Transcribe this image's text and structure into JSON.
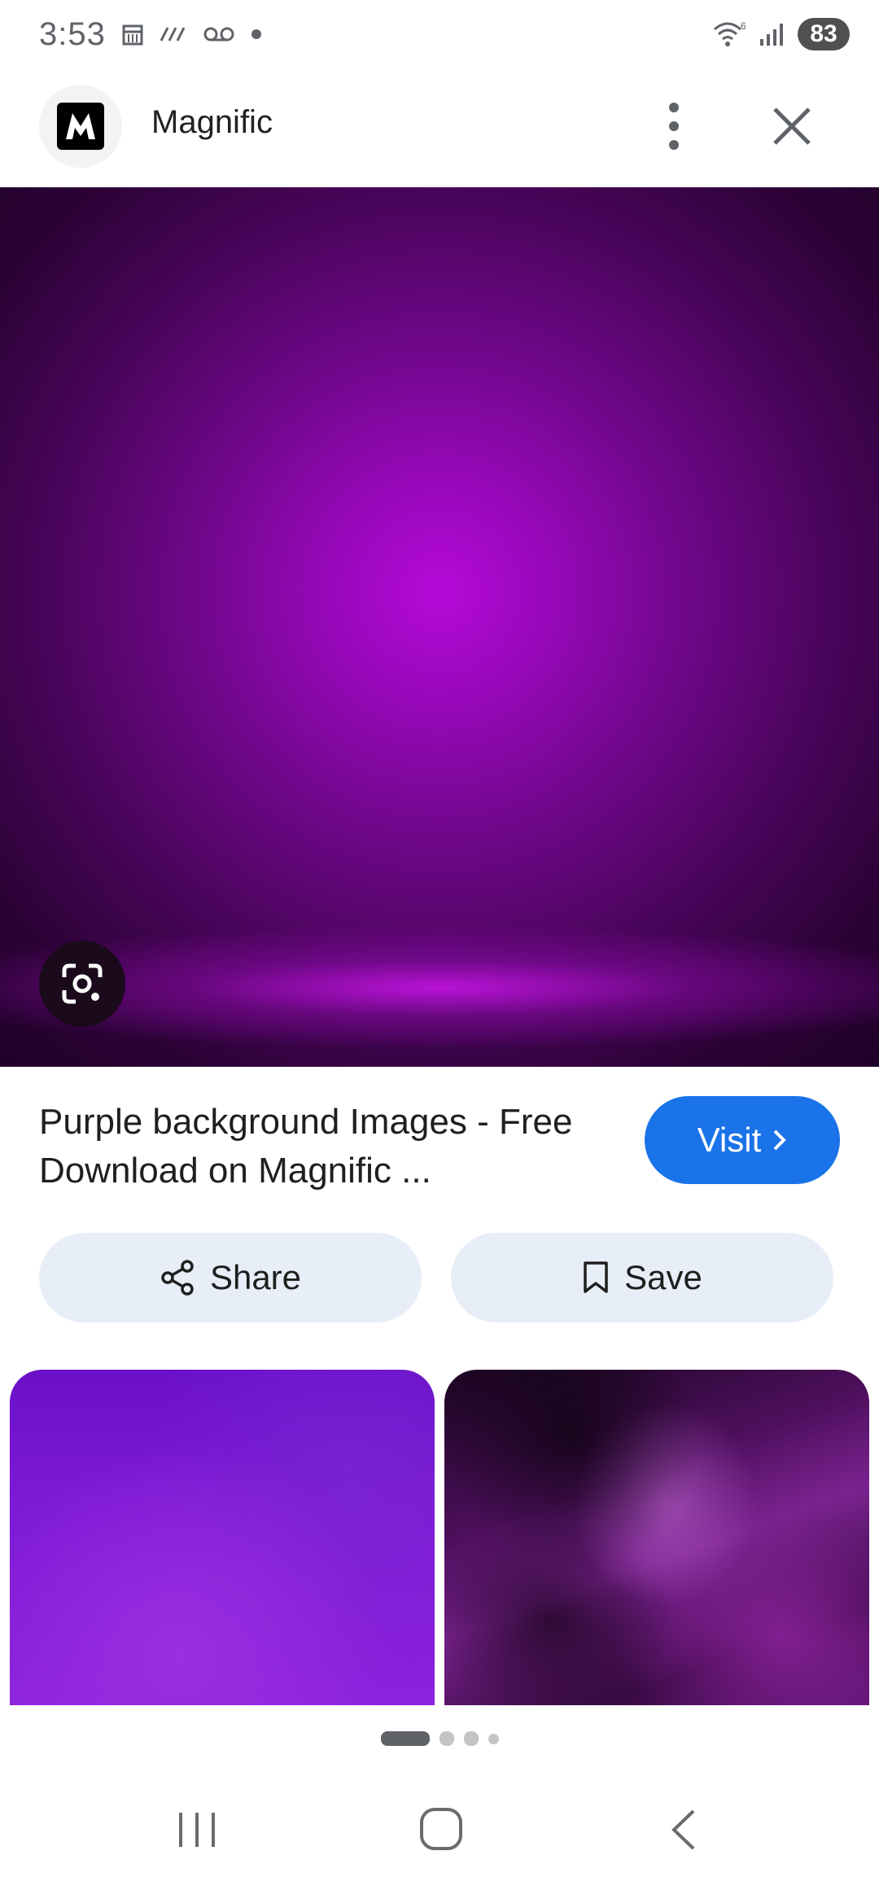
{
  "status_bar": {
    "time": "3:53",
    "battery": "83"
  },
  "header": {
    "site_name": "Magnific"
  },
  "result": {
    "title": "Purple background Images - Free Download on Magnific ...",
    "visit_label": "Visit"
  },
  "actions": {
    "share_label": "Share",
    "save_label": "Save"
  },
  "pager": {
    "current_page": 1,
    "total_dots": 4
  },
  "colors": {
    "accent": "#1a73e8",
    "pill_bg": "#e8eef8",
    "hero_center": "#b50ad8"
  },
  "icons": [
    "calendar-icon",
    "signal-strength-icon",
    "voicemail-icon",
    "notification-dot-icon",
    "wifi-icon",
    "cellular-icon",
    "more-vert-icon",
    "close-icon",
    "lens-icon",
    "chevron-right-icon",
    "share-icon",
    "bookmark-icon",
    "recents-icon",
    "home-icon",
    "back-icon"
  ]
}
